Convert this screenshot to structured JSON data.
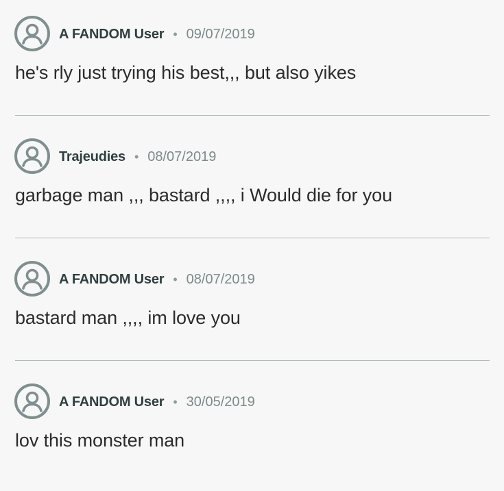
{
  "colors": {
    "background": "#f7f7f7",
    "username": "#2f3f3f",
    "date": "#7b8a8a",
    "text": "#2b2b2b",
    "divider": "#aeb9b9",
    "avatar_stroke": "#7f8f8f"
  },
  "comments": [
    {
      "avatar_icon": "user-avatar-icon",
      "username": "A FANDOM User",
      "separator": "•",
      "date": "09/07/2019",
      "text": "he's rly just trying his best,,, but also yikes"
    },
    {
      "avatar_icon": "user-avatar-icon",
      "username": "Trajeudies",
      "separator": "•",
      "date": "08/07/2019",
      "text": "garbage man ,,, bastard ,,,, i Would die for you"
    },
    {
      "avatar_icon": "user-avatar-icon",
      "username": "A FANDOM User",
      "separator": "•",
      "date": "08/07/2019",
      "text": "bastard man ,,,, im love you"
    },
    {
      "avatar_icon": "user-avatar-icon",
      "username": "A FANDOM User",
      "separator": "•",
      "date": "30/05/2019",
      "text": "lov this monster man"
    }
  ]
}
